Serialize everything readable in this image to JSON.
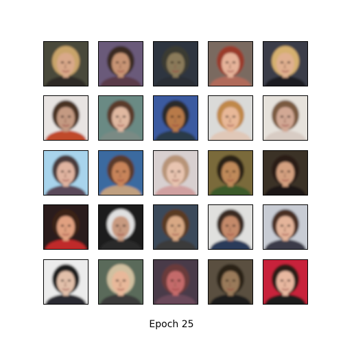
{
  "caption": "Epoch 25",
  "grid": {
    "rows": 5,
    "cols": 5
  },
  "tiles": [
    {
      "bg": "#4a4a3a",
      "skin": "#d9a98a",
      "hair": "#c9a46a",
      "shirt": "#2d2a28"
    },
    {
      "bg": "#6b5a7a",
      "skin": "#c89474",
      "hair": "#3a2a22",
      "shirt": "#5a3a4a"
    },
    {
      "bg": "#2e3540",
      "skin": "#8a7a5a",
      "hair": "#3a3a30",
      "shirt": "#2a2e36"
    },
    {
      "bg": "#7a6a60",
      "skin": "#e6b39a",
      "hair": "#9a3a2a",
      "shirt": "#b06a5a"
    },
    {
      "bg": "#3a3e4a",
      "skin": "#e0b090",
      "hair": "#d6b070",
      "shirt": "#1a1a24"
    },
    {
      "bg": "#e8e4e2",
      "skin": "#c49a82",
      "hair": "#4a3024",
      "shirt": "#c04a2a"
    },
    {
      "bg": "#6a8a84",
      "skin": "#e0b8a0",
      "hair": "#5a3a2a",
      "shirt": "#7a8a84"
    },
    {
      "bg": "#3a5aa0",
      "skin": "#b87a4a",
      "hair": "#2a2a2a",
      "shirt": "#2a3a4a"
    },
    {
      "bg": "#dadad8",
      "skin": "#e8b898",
      "hair": "#c0884a",
      "shirt": "#e0c8b8"
    },
    {
      "bg": "#e6e2dc",
      "skin": "#d2a894",
      "hair": "#7a5a40",
      "shirt": "#d8ccc4"
    },
    {
      "bg": "#a8d4ec",
      "skin": "#e0b4a0",
      "hair": "#4a3a3a",
      "shirt": "#5a4a5a"
    },
    {
      "bg": "#3a6aa0",
      "skin": "#c8845a",
      "hair": "#5a3a2a",
      "shirt": "#c0a080"
    },
    {
      "bg": "#d8d0d0",
      "skin": "#e8c4b0",
      "hair": "#b89478",
      "shirt": "#d0a0a0"
    },
    {
      "bg": "#7a6a3a",
      "skin": "#c08a5a",
      "hair": "#2a2018",
      "shirt": "#3a5a2a"
    },
    {
      "bg": "#3a3028",
      "skin": "#d4a080",
      "hair": "#2a1a14",
      "shirt": "#1a1614"
    },
    {
      "bg": "#2a1a1a",
      "skin": "#e0a080",
      "hair": "#3a2218",
      "shirt": "#c02a2a"
    },
    {
      "bg": "#1a1a1a",
      "skin": "#c89a80",
      "hair": "#e0e0e0",
      "shirt": "#2a2a2a"
    },
    {
      "bg": "#3a4a5a",
      "skin": "#d8a884",
      "hair": "#5a3a24",
      "shirt": "#3a3a3a"
    },
    {
      "bg": "#e0e0de",
      "skin": "#c48a6a",
      "hair": "#3a2a24",
      "shirt": "#2a3a5a"
    },
    {
      "bg": "#c8ccd4",
      "skin": "#e4b49a",
      "hair": "#4a2e22",
      "shirt": "#3a3a4a"
    },
    {
      "bg": "#ececec",
      "skin": "#e2c0aa",
      "hair": "#1a1a1a",
      "shirt": "#2a2a30"
    },
    {
      "bg": "#5a6a5a",
      "skin": "#e8b89a",
      "hair": "#d0c0a0",
      "shirt": "#3a3a3a"
    },
    {
      "bg": "#4a3a4a",
      "skin": "#c46a6a",
      "hair": "#6a3a3a",
      "shirt": "#6a4a5a"
    },
    {
      "bg": "#5a5040",
      "skin": "#9a7a5a",
      "hair": "#2a2418",
      "shirt": "#1a1a1a"
    },
    {
      "bg": "#c8243a",
      "skin": "#e8b8a0",
      "hair": "#2a1a18",
      "shirt": "#1a1a1a"
    }
  ]
}
